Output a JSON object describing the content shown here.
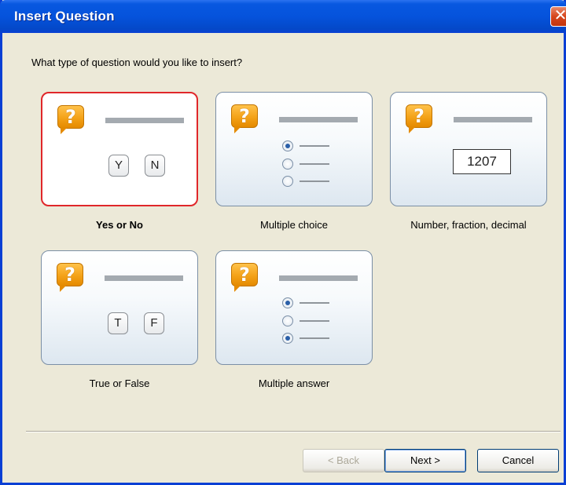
{
  "window": {
    "title": "Insert Question"
  },
  "prompt": "What type of question would you like to insert?",
  "cards": [
    {
      "label": "Yes or No",
      "selected": true,
      "buttons": [
        "Y",
        "N"
      ]
    },
    {
      "label": "Multiple choice",
      "selected": false
    },
    {
      "label": "Number, fraction, decimal",
      "selected": false,
      "value": "1207"
    },
    {
      "label": "True or False",
      "selected": false,
      "buttons": [
        "T",
        "F"
      ]
    },
    {
      "label": "Multiple answer",
      "selected": false
    }
  ],
  "icon_glyph": "?",
  "buttons": {
    "back": "< Back",
    "next": "Next >",
    "cancel": "Cancel"
  },
  "colors": {
    "selected_border": "#e0272a",
    "titlebar": "#0553dc",
    "icon": "#f4a218"
  }
}
